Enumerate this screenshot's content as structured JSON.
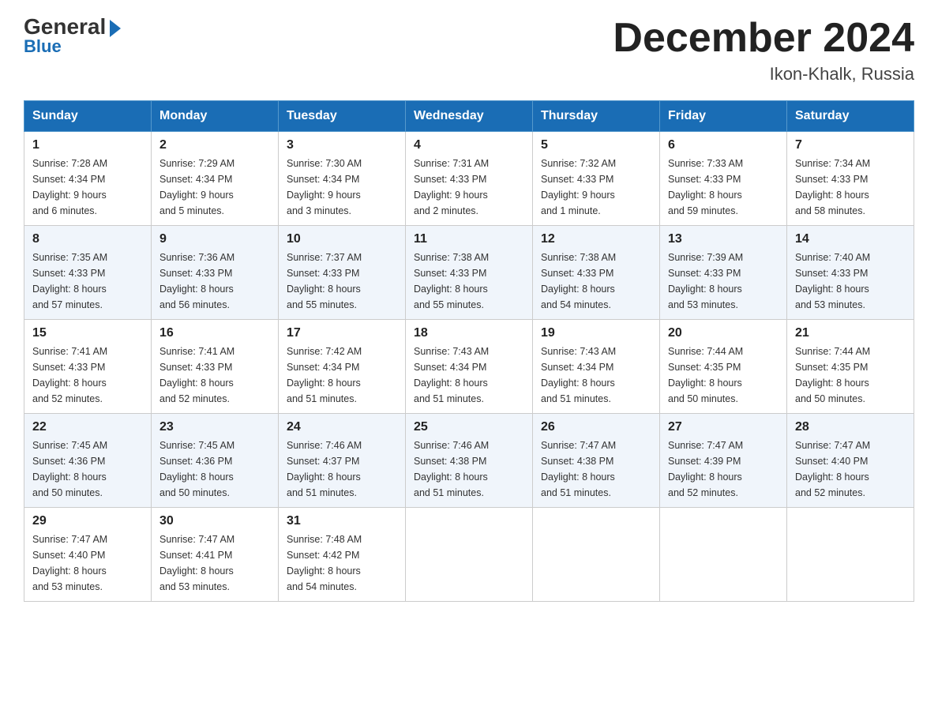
{
  "header": {
    "logo_general": "General",
    "logo_blue": "Blue",
    "month_title": "December 2024",
    "location": "Ikon-Khalk, Russia"
  },
  "days_of_week": [
    "Sunday",
    "Monday",
    "Tuesday",
    "Wednesday",
    "Thursday",
    "Friday",
    "Saturday"
  ],
  "weeks": [
    [
      {
        "day": "1",
        "sunrise": "7:28 AM",
        "sunset": "4:34 PM",
        "daylight": "9 hours and 6 minutes."
      },
      {
        "day": "2",
        "sunrise": "7:29 AM",
        "sunset": "4:34 PM",
        "daylight": "9 hours and 5 minutes."
      },
      {
        "day": "3",
        "sunrise": "7:30 AM",
        "sunset": "4:34 PM",
        "daylight": "9 hours and 3 minutes."
      },
      {
        "day": "4",
        "sunrise": "7:31 AM",
        "sunset": "4:33 PM",
        "daylight": "9 hours and 2 minutes."
      },
      {
        "day": "5",
        "sunrise": "7:32 AM",
        "sunset": "4:33 PM",
        "daylight": "9 hours and 1 minute."
      },
      {
        "day": "6",
        "sunrise": "7:33 AM",
        "sunset": "4:33 PM",
        "daylight": "8 hours and 59 minutes."
      },
      {
        "day": "7",
        "sunrise": "7:34 AM",
        "sunset": "4:33 PM",
        "daylight": "8 hours and 58 minutes."
      }
    ],
    [
      {
        "day": "8",
        "sunrise": "7:35 AM",
        "sunset": "4:33 PM",
        "daylight": "8 hours and 57 minutes."
      },
      {
        "day": "9",
        "sunrise": "7:36 AM",
        "sunset": "4:33 PM",
        "daylight": "8 hours and 56 minutes."
      },
      {
        "day": "10",
        "sunrise": "7:37 AM",
        "sunset": "4:33 PM",
        "daylight": "8 hours and 55 minutes."
      },
      {
        "day": "11",
        "sunrise": "7:38 AM",
        "sunset": "4:33 PM",
        "daylight": "8 hours and 55 minutes."
      },
      {
        "day": "12",
        "sunrise": "7:38 AM",
        "sunset": "4:33 PM",
        "daylight": "8 hours and 54 minutes."
      },
      {
        "day": "13",
        "sunrise": "7:39 AM",
        "sunset": "4:33 PM",
        "daylight": "8 hours and 53 minutes."
      },
      {
        "day": "14",
        "sunrise": "7:40 AM",
        "sunset": "4:33 PM",
        "daylight": "8 hours and 53 minutes."
      }
    ],
    [
      {
        "day": "15",
        "sunrise": "7:41 AM",
        "sunset": "4:33 PM",
        "daylight": "8 hours and 52 minutes."
      },
      {
        "day": "16",
        "sunrise": "7:41 AM",
        "sunset": "4:33 PM",
        "daylight": "8 hours and 52 minutes."
      },
      {
        "day": "17",
        "sunrise": "7:42 AM",
        "sunset": "4:34 PM",
        "daylight": "8 hours and 51 minutes."
      },
      {
        "day": "18",
        "sunrise": "7:43 AM",
        "sunset": "4:34 PM",
        "daylight": "8 hours and 51 minutes."
      },
      {
        "day": "19",
        "sunrise": "7:43 AM",
        "sunset": "4:34 PM",
        "daylight": "8 hours and 51 minutes."
      },
      {
        "day": "20",
        "sunrise": "7:44 AM",
        "sunset": "4:35 PM",
        "daylight": "8 hours and 50 minutes."
      },
      {
        "day": "21",
        "sunrise": "7:44 AM",
        "sunset": "4:35 PM",
        "daylight": "8 hours and 50 minutes."
      }
    ],
    [
      {
        "day": "22",
        "sunrise": "7:45 AM",
        "sunset": "4:36 PM",
        "daylight": "8 hours and 50 minutes."
      },
      {
        "day": "23",
        "sunrise": "7:45 AM",
        "sunset": "4:36 PM",
        "daylight": "8 hours and 50 minutes."
      },
      {
        "day": "24",
        "sunrise": "7:46 AM",
        "sunset": "4:37 PM",
        "daylight": "8 hours and 51 minutes."
      },
      {
        "day": "25",
        "sunrise": "7:46 AM",
        "sunset": "4:38 PM",
        "daylight": "8 hours and 51 minutes."
      },
      {
        "day": "26",
        "sunrise": "7:47 AM",
        "sunset": "4:38 PM",
        "daylight": "8 hours and 51 minutes."
      },
      {
        "day": "27",
        "sunrise": "7:47 AM",
        "sunset": "4:39 PM",
        "daylight": "8 hours and 52 minutes."
      },
      {
        "day": "28",
        "sunrise": "7:47 AM",
        "sunset": "4:40 PM",
        "daylight": "8 hours and 52 minutes."
      }
    ],
    [
      {
        "day": "29",
        "sunrise": "7:47 AM",
        "sunset": "4:40 PM",
        "daylight": "8 hours and 53 minutes."
      },
      {
        "day": "30",
        "sunrise": "7:47 AM",
        "sunset": "4:41 PM",
        "daylight": "8 hours and 53 minutes."
      },
      {
        "day": "31",
        "sunrise": "7:48 AM",
        "sunset": "4:42 PM",
        "daylight": "8 hours and 54 minutes."
      },
      null,
      null,
      null,
      null
    ]
  ],
  "labels": {
    "sunrise": "Sunrise:",
    "sunset": "Sunset:",
    "daylight": "Daylight:"
  }
}
